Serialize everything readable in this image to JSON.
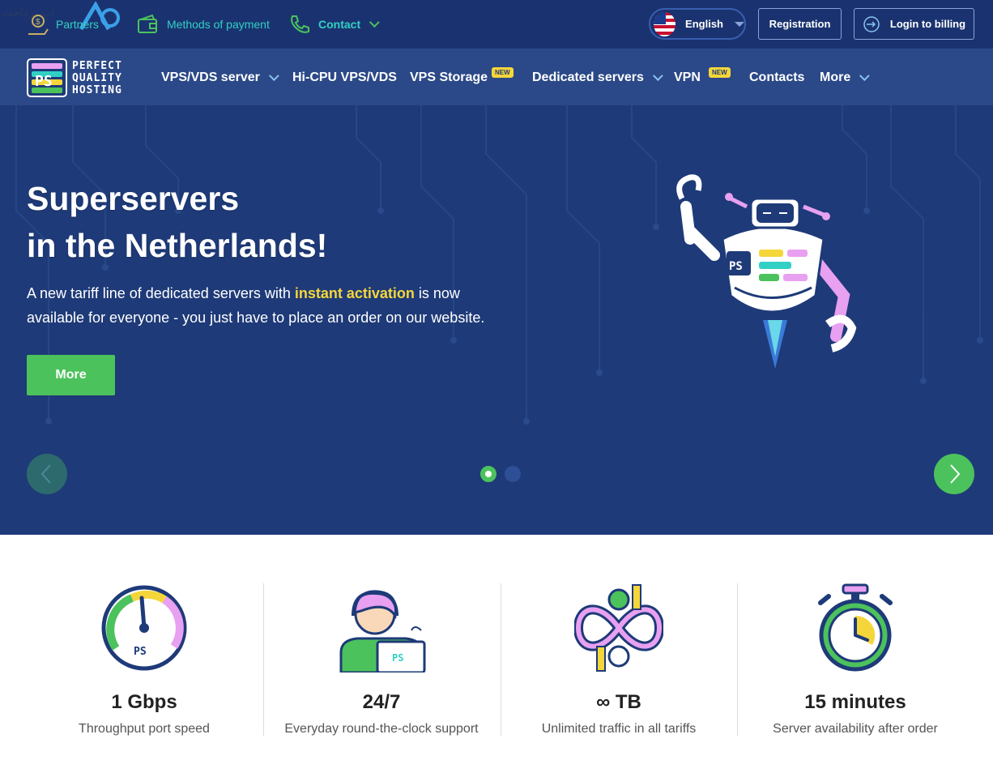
{
  "topbar": {
    "watermark_text": "اپ پرداخت",
    "partners": "Partners",
    "methods_of_payment": "Methods of payment",
    "contact": "Contact",
    "language": "English",
    "registration": "Registration",
    "login": "Login to billing"
  },
  "logo": {
    "line1": "PERFECT",
    "line2": "QUALITY",
    "line3": "HOSTING"
  },
  "nav": {
    "items": [
      {
        "label": "VPS/VDS server",
        "dropdown": true
      },
      {
        "label": "Hi-CPU VPS/VDS"
      },
      {
        "label": "VPS Storage",
        "badge": "NEW"
      },
      {
        "label": "Dedicated servers",
        "dropdown": true
      },
      {
        "label": "VPN",
        "badge": "NEW"
      },
      {
        "label": "Contacts"
      },
      {
        "label": "More",
        "dropdown": true
      }
    ]
  },
  "hero": {
    "title_line1": "Superservers",
    "title_line2": "in the Netherlands!",
    "desc_before": "A new tariff line of dedicated servers with ",
    "desc_highlight": "instant activation",
    "desc_after": " is now available for everyone - you just have to place an order on our website.",
    "button": "More",
    "slides_total": 2,
    "active_slide": 1
  },
  "features": [
    {
      "value": "1 Gbps",
      "label": "Throughput port speed",
      "icon": "speedometer-icon"
    },
    {
      "value": "24/7",
      "label": "Everyday round-the-clock support",
      "icon": "support-operator-icon"
    },
    {
      "value": "∞ TB",
      "label": "Unlimited traffic in all tariffs",
      "icon": "infinity-traffic-icon"
    },
    {
      "value": "15 minutes",
      "label": "Server availability after order",
      "icon": "stopwatch-icon"
    }
  ],
  "colors": {
    "hero_bg": "#1e3a78",
    "accent_green": "#4cc25c",
    "accent_teal": "#32d0c4",
    "highlight_yellow": "#f5d63a"
  }
}
